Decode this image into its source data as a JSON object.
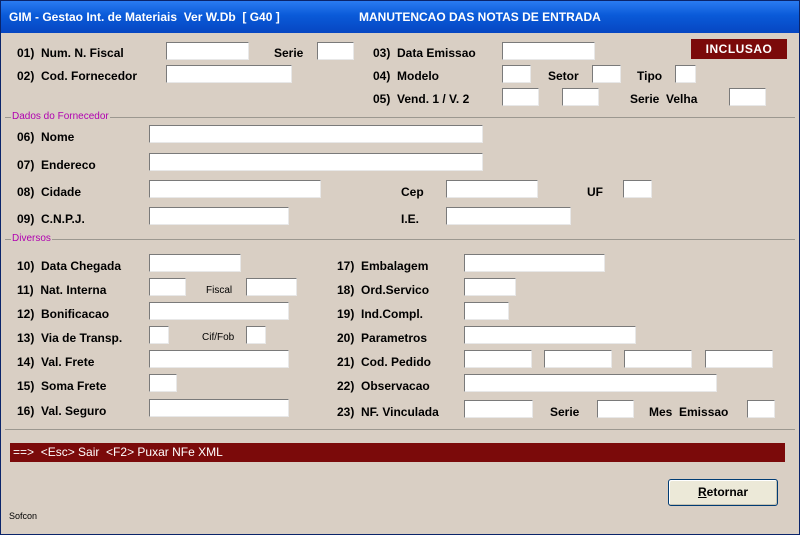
{
  "window": {
    "title_left": "GIM - Gestao Int. de Materiais  Ver W.Db  [ G40 ]",
    "title_right": "MANUTENCAO DAS NOTAS DE ENTRADA"
  },
  "mode_badge": "INCLUSAO",
  "header": {
    "f01": "01)  Num. N. Fiscal",
    "serie": "Serie",
    "f02": "02)  Cod. Fornecedor",
    "f03": "03)  Data Emissao",
    "f04": "04)  Modelo",
    "setor": "Setor",
    "tipo": "Tipo",
    "f05": "05)  Vend. 1 / V. 2",
    "serie_velha": "Serie  Velha"
  },
  "groups": {
    "fornecedor": "Dados do Fornecedor",
    "diversos": "Diversos"
  },
  "fornecedor": {
    "f06": "06)  Nome",
    "f07": "07)  Endereco",
    "f08": "08)  Cidade",
    "cep": "Cep",
    "uf": "UF",
    "f09": "09)  C.N.P.J.",
    "ie": "I.E."
  },
  "diversos": {
    "f10": "10)  Data Chegada",
    "f11": "11)  Nat. Interna",
    "fiscal": "Fiscal",
    "f12": "12)  Bonificacao",
    "f13": "13)  Via de Transp.",
    "cif_fob": "Cif/Fob",
    "f14": "14)  Val. Frete",
    "f15": "15)  Soma Frete",
    "f16": "16)  Val. Seguro",
    "f17": "17)  Embalagem",
    "f18": "18)  Ord.Servico",
    "f19": "19)  Ind.Compl.",
    "f20": "20)  Parametros",
    "f21": "21)  Cod. Pedido",
    "f22": "22)  Observacao",
    "f23": "23)  NF. Vinculada",
    "serie": "Serie",
    "mes_emissao": "Mes  Emissao"
  },
  "status_bar": "==>  <Esc> Sair  <F2> Puxar NFe XML",
  "button": {
    "label_underlined": "R",
    "label_rest": "etornar"
  },
  "footer": "Sofcon"
}
